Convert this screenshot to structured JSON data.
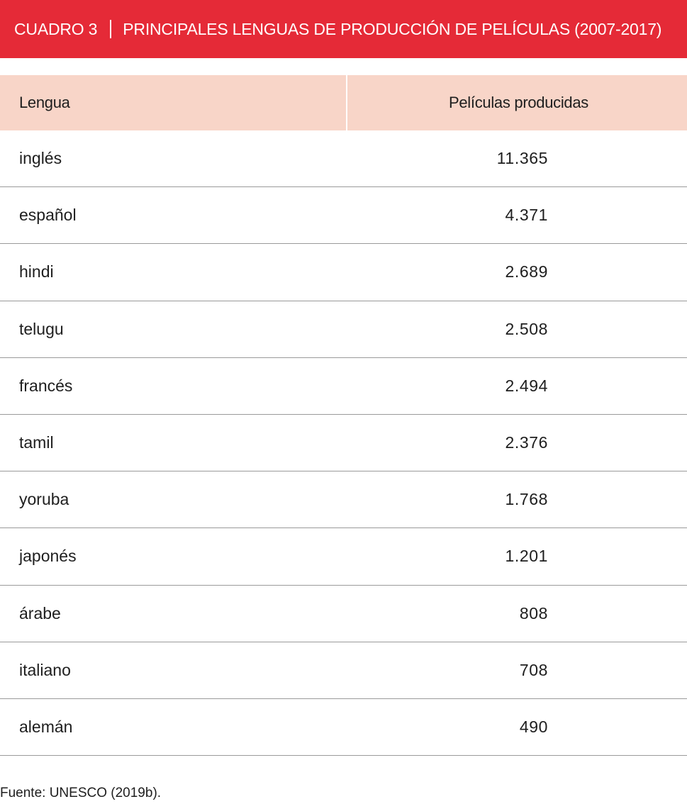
{
  "title": {
    "number": "CUADRO 3",
    "text": "PRINCIPALES LENGUAS DE PRODUCCIÓN DE PELÍCULAS (2007-2017)"
  },
  "colors": {
    "title_bar": "#e52a37",
    "header_row": "#f8d5c8",
    "row_divider": "#9a9a9a"
  },
  "table": {
    "headers": {
      "language": "Lengua",
      "films": "Películas producidas"
    },
    "rows": [
      {
        "language": "inglés",
        "films": "11.365"
      },
      {
        "language": "español",
        "films": "4.371"
      },
      {
        "language": "hindi",
        "films": "2.689"
      },
      {
        "language": "telugu",
        "films": "2.508"
      },
      {
        "language": "francés",
        "films": "2.494"
      },
      {
        "language": "tamil",
        "films": "2.376"
      },
      {
        "language": "yoruba",
        "films": "1.768"
      },
      {
        "language": "japonés",
        "films": "1.201"
      },
      {
        "language": "árabe",
        "films": "808"
      },
      {
        "language": "italiano",
        "films": "708"
      },
      {
        "language": "alemán",
        "films": "490"
      }
    ]
  },
  "chart_data": {
    "type": "table",
    "title": "PRINCIPALES LENGUAS DE PRODUCCIÓN DE PELÍCULAS (2007-2017)",
    "columns": [
      "Lengua",
      "Películas producidas"
    ],
    "categories": [
      "inglés",
      "español",
      "hindi",
      "telugu",
      "francés",
      "tamil",
      "yoruba",
      "japonés",
      "árabe",
      "italiano",
      "alemán"
    ],
    "values": [
      11365,
      4371,
      2689,
      2508,
      2494,
      2376,
      1768,
      1201,
      808,
      708,
      490
    ]
  },
  "source": "Fuente: UNESCO (2019b)."
}
